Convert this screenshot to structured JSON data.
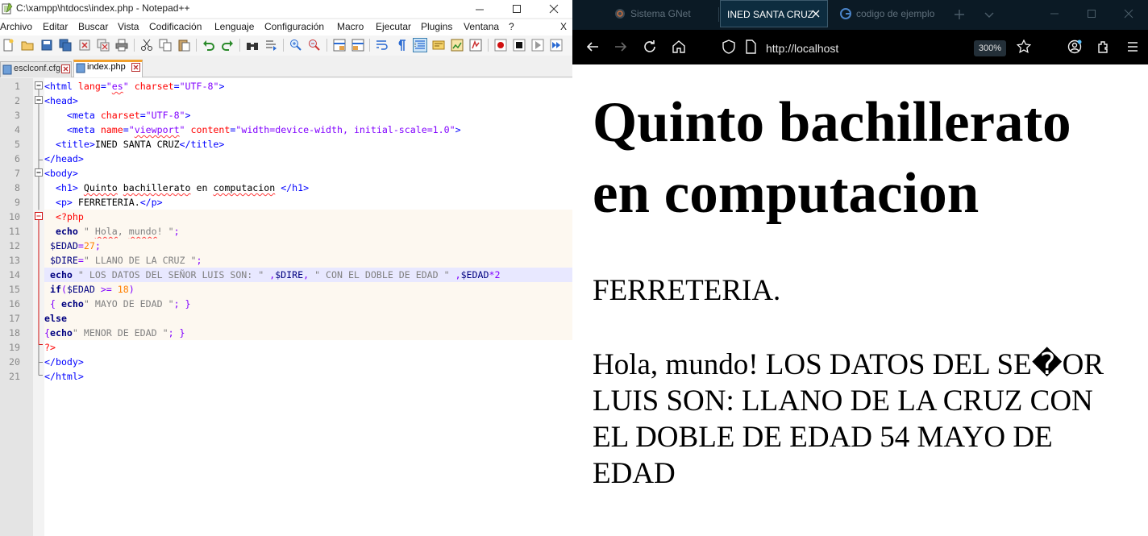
{
  "notepad": {
    "title": "C:\\xampp\\htdocs\\index.php - Notepad++",
    "menu": [
      "Archivo",
      "Editar",
      "Buscar",
      "Vista",
      "Codificación",
      "Lenguaje",
      "Configuración",
      "Macro",
      "Ejecutar",
      "Plugins",
      "Ventana",
      "?"
    ],
    "menu_close": "X",
    "tabs": [
      {
        "label": "esclconf.cfg",
        "active": false
      },
      {
        "label": "index.php",
        "active": true
      }
    ],
    "line_numbers": [
      "1",
      "2",
      "3",
      "4",
      "5",
      "6",
      "7",
      "8",
      "9",
      "10",
      "11",
      "12",
      "13",
      "14",
      "15",
      "16",
      "17",
      "18",
      "19",
      "20",
      "21"
    ],
    "code": {
      "l1": {
        "t1": "<html ",
        "a1": "lang",
        "eq1": "=",
        "v1a": "\"",
        "v1b": "es",
        "v1c": "\"",
        "sp": " ",
        "a2": "charset",
        "eq2": "=",
        "v2": "\"UTF-8\"",
        "t2": ">"
      },
      "l2": {
        "t1": "<head>"
      },
      "l3": {
        "ind": "    ",
        "t1": "<meta ",
        "a1": "charset",
        "eq1": "=",
        "v1": "\"UTF-8\"",
        "t2": ">"
      },
      "l4": {
        "ind": "    ",
        "t1": "<meta ",
        "a1": "name",
        "eq1": "=",
        "v1a": "\"",
        "v1b": "viewport",
        "v1c": "\"",
        "sp": " ",
        "a2": "content",
        "eq2": "=",
        "v2": "\"width=device-width, initial-scale=1.0\"",
        "t2": ">"
      },
      "l5": {
        "ind": "  ",
        "t1": "<title>",
        "tx": "INED SANTA CRUZ",
        "t2": "</title>"
      },
      "l6": {
        "t1": "</head>"
      },
      "l7": {
        "t1": "<body>"
      },
      "l8": {
        "ind": "  ",
        "t1": "<h1>",
        "sp": " ",
        "w1": "Quinto",
        "sp2": " ",
        "w2": "bachillerato",
        "mid": " en ",
        "w3": "computacion",
        "sp3": " ",
        "t2": "</h1>"
      },
      "l9": {
        "ind": "  ",
        "t1": "<p>",
        "tx": " FERRETERIA.",
        "t2": "</p>"
      },
      "l10": {
        "ind": "  ",
        "pt": "<?php"
      },
      "l11": {
        "ind": "  ",
        "kw": "echo",
        "s1": " \" ",
        "s2": "Hola",
        "s3": ", ",
        "s4": "mundo",
        "s5": "! \"",
        "op": ";"
      },
      "l12": {
        "ind": " ",
        "var": "$EDAD",
        "op": "=",
        "num": "27",
        "op2": ";"
      },
      "l13": {
        "ind": " ",
        "var": "$DIRE",
        "op": "=",
        "s": "\" LLANO DE LA CRUZ \"",
        "op2": ";"
      },
      "l14": {
        "ind": " ",
        "kw": "echo",
        "s": " \" LOS DATOS DEL SEÑOR LUIS SON: \" ",
        "op1": ",",
        "var1": "$DIRE",
        "op2": ",",
        "s2": " \" CON EL DOBLE DE EDAD \" ",
        "op3": ",",
        "var2": "$EDAD",
        "op4": "*2"
      },
      "l15": {
        "ind": " ",
        "kw": "if",
        "op1": "(",
        "var": "$EDAD",
        "op2": " >= ",
        "num": "18",
        "op3": ")"
      },
      "l16": {
        "ind": " ",
        "op1": "{ ",
        "kw": "echo",
        "s": "\" MAYO DE EDAD \"",
        "op2": "; }"
      },
      "l17": {
        "kw": "else"
      },
      "l18": {
        "op1": "{",
        "kw": "echo",
        "s": "\" MENOR DE EDAD \"",
        "op2": "; }"
      },
      "l19": {
        "pt": "?>"
      },
      "l20": {
        "t1": "</body>"
      },
      "l21": {
        "t1": "</html>"
      }
    }
  },
  "browser": {
    "tabs": [
      {
        "label": "Sistema GNet",
        "active": false,
        "icon": "gnet-icon"
      },
      {
        "label": "INED SANTA CRUZ",
        "active": true,
        "icon": ""
      },
      {
        "label": "codigo de ejemplo",
        "active": false,
        "icon": "google-icon"
      }
    ],
    "url": "http://localhost",
    "zoom": "300%",
    "page": {
      "h1": "Quinto bachillerato en computacion",
      "p": "FERRETERIA.",
      "output": "Hola, mundo! LOS DATOS DEL SE�OR LUIS SON: LLANO DE LA CRUZ CON EL DOBLE DE EDAD 54 MAYO DE EDAD"
    }
  },
  "colors": {
    "browser_tabbar": "#0b1a25",
    "browser_toolbar": "#000000",
    "accent_tab_border": "#f1a02c"
  }
}
